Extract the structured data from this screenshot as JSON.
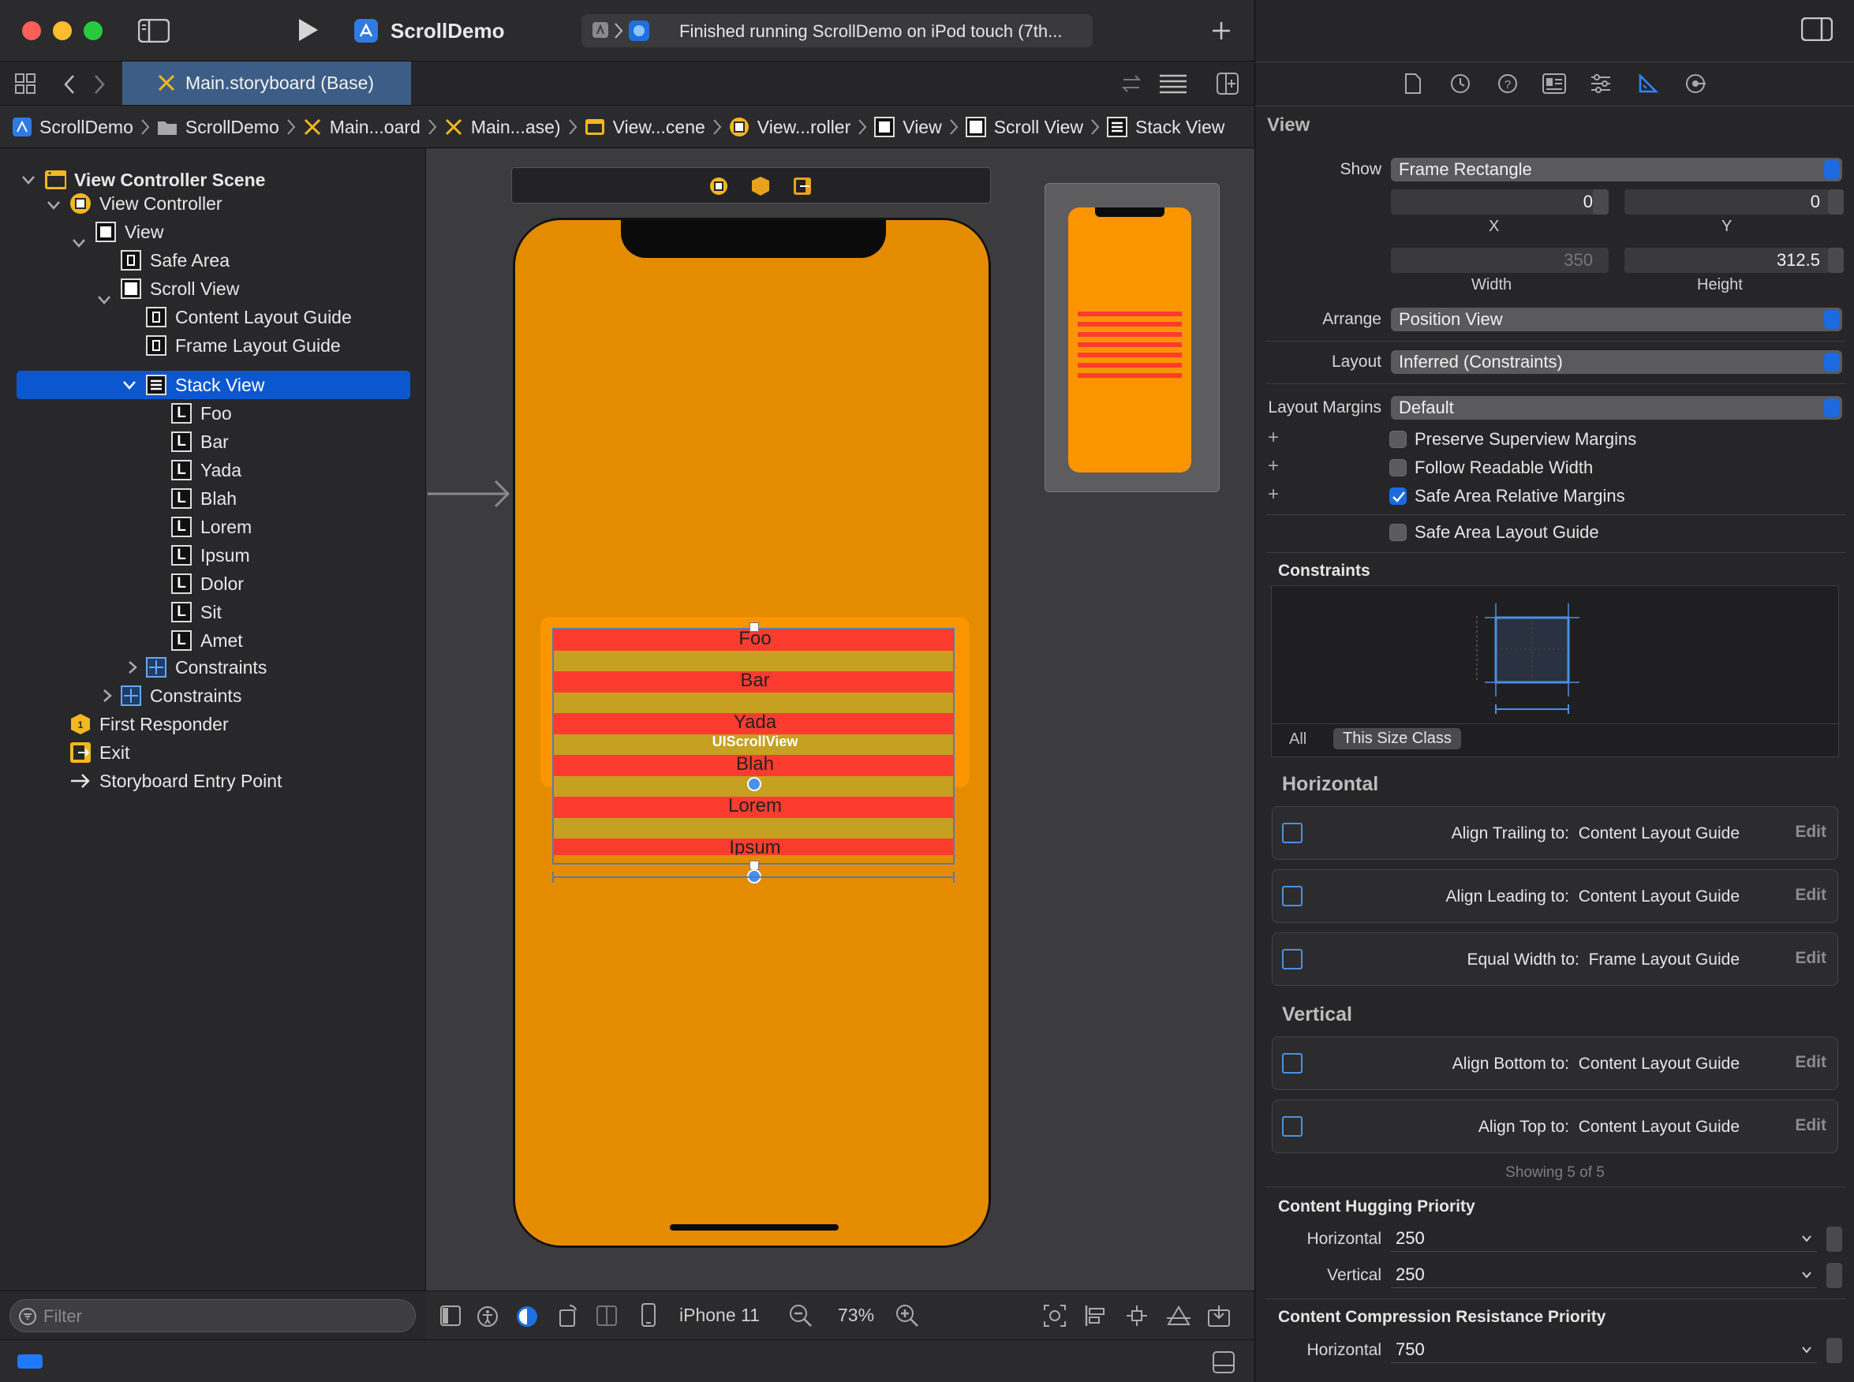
{
  "toolbar": {
    "scheme": "ScrollDemo",
    "status": "Finished running ScrollDemo on iPod touch (7th...",
    "colors": {
      "close": "#fe5f57",
      "minimize": "#febc2e",
      "zoom": "#28c840"
    }
  },
  "tabbar": {
    "active_tab": "Main.storyboard (Base)"
  },
  "jumpbar": {
    "items": [
      "ScrollDemo",
      "ScrollDemo",
      "Main...oard",
      "Main...ase)",
      "View...cene",
      "View...roller",
      "View",
      "Scroll View",
      "Stack View"
    ]
  },
  "navigator": {
    "scene": "View Controller Scene",
    "controller": "View Controller",
    "view": "View",
    "safe_area": "Safe Area",
    "scroll_view": "Scroll View",
    "content_layout_guide": "Content Layout Guide",
    "frame_layout_guide": "Frame Layout Guide",
    "stack_view": "Stack View",
    "labels": [
      "Foo",
      "Bar",
      "Yada",
      "Blah",
      "Lorem",
      "Ipsum",
      "Dolor",
      "Sit",
      "Amet"
    ],
    "constraints_inner": "Constraints",
    "constraints_outer": "Constraints",
    "first_responder": "First Responder",
    "exit": "Exit",
    "entry_point": "Storyboard Entry Point",
    "filter_placeholder": "Filter"
  },
  "canvas": {
    "stack_labels": [
      "Foo",
      "Bar",
      "Yada",
      "Blah",
      "Lorem",
      "Ipsum"
    ],
    "scroll_overlay": "UIScrollView",
    "device": "iPhone 11",
    "zoom": "73%",
    "colors": {
      "view_bg": "#e48b00",
      "label_bg": "#fd3c30",
      "spacer": "#c6a020"
    }
  },
  "inspector": {
    "section": "View",
    "show_label": "Show",
    "show_value": "Frame Rectangle",
    "x_value": "0",
    "y_value": "0",
    "x_label": "X",
    "y_label": "Y",
    "width_value": "350",
    "height_value": "312.5",
    "width_label": "Width",
    "height_label": "Height",
    "arrange_label": "Arrange",
    "arrange_value": "Position View",
    "layout_label": "Layout",
    "layout_value": "Inferred (Constraints)",
    "layout_margins_label": "Layout Margins",
    "layout_margins_value": "Default",
    "checkboxes": [
      {
        "label": "Preserve Superview Margins",
        "checked": false
      },
      {
        "label": "Follow Readable Width",
        "checked": false
      },
      {
        "label": "Safe Area Relative Margins",
        "checked": true
      },
      {
        "label": "Safe Area Layout Guide",
        "checked": false
      }
    ],
    "constraints_title": "Constraints",
    "size_tabs": [
      "All",
      "This Size Class"
    ],
    "horizontal_title": "Horizontal",
    "horizontal": [
      {
        "kind": "Align Trailing to:",
        "target": "Content Layout Guide",
        "edit": "Edit"
      },
      {
        "kind": "Align Leading to:",
        "target": "Content Layout Guide",
        "edit": "Edit"
      },
      {
        "kind": "Equal Width to:",
        "target": "Frame Layout Guide",
        "edit": "Edit"
      }
    ],
    "vertical_title": "Vertical",
    "vertical": [
      {
        "kind": "Align Bottom to:",
        "target": "Content Layout Guide",
        "edit": "Edit"
      },
      {
        "kind": "Align Top to:",
        "target": "Content Layout Guide",
        "edit": "Edit"
      }
    ],
    "showing": "Showing 5 of 5",
    "hugging_title": "Content Hugging Priority",
    "hugging_h_label": "Horizontal",
    "hugging_h": "250",
    "hugging_v_label": "Vertical",
    "hugging_v": "250",
    "compression_title": "Content Compression Resistance Priority",
    "compression_h_label": "Horizontal",
    "compression_h": "750"
  }
}
